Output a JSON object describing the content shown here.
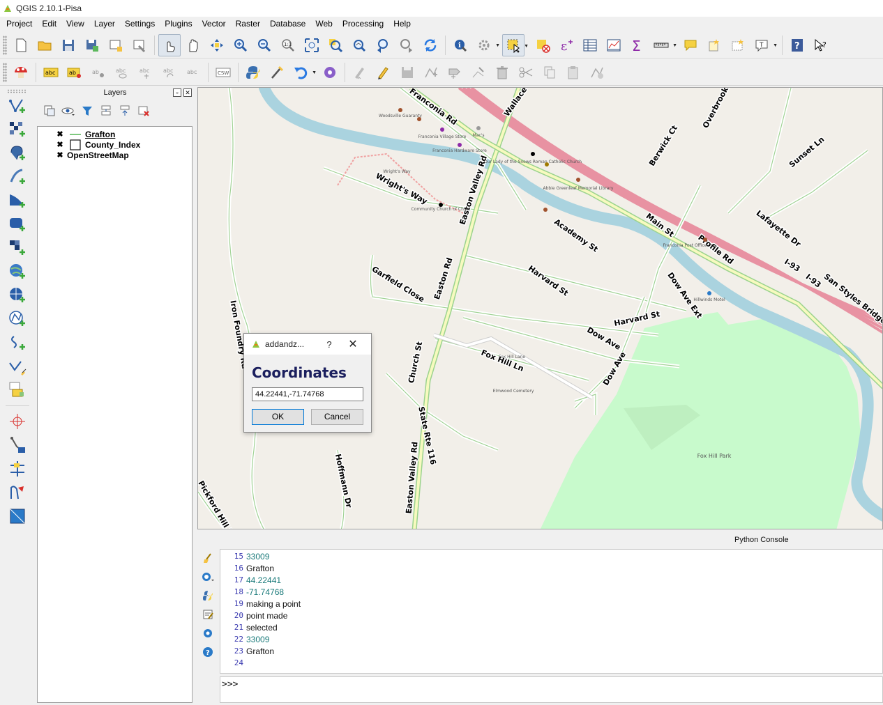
{
  "window": {
    "title": "QGIS 2.10.1-Pisa"
  },
  "menu": [
    "Project",
    "Edit",
    "View",
    "Layer",
    "Settings",
    "Plugins",
    "Vector",
    "Raster",
    "Database",
    "Web",
    "Processing",
    "Help"
  ],
  "toolbar1": {
    "icons": [
      "new-project-icon",
      "open-project-icon",
      "save-project-icon",
      "save-as-icon",
      "new-print-composer-icon",
      "composer-manager-icon",
      "touch-zoom-icon",
      "pan-icon",
      "pan-to-selection-icon",
      "zoom-in-icon",
      "zoom-out-icon",
      "zoom-native-icon",
      "zoom-full-icon",
      "zoom-to-selection-icon",
      "zoom-to-layer-icon",
      "zoom-last-icon",
      "zoom-next-icon",
      "refresh-icon",
      "identify-icon",
      "run-action-icon",
      "select-features-icon",
      "deselect-icon",
      "field-calculator-icon",
      "attribute-table-icon",
      "statistics-icon",
      "sum-icon",
      "measure-icon",
      "map-tips-icon",
      "new-bookmark-icon",
      "show-bookmarks-icon",
      "text-annotation-icon",
      "help-contents-icon",
      "whats-this-icon"
    ]
  },
  "toolbar2": {
    "csw_label": "CSW",
    "label_tool_text": "abc"
  },
  "layers_panel": {
    "title": "Layers",
    "layers": [
      {
        "name": "Grafton",
        "checked": true,
        "symbol": "line",
        "underline": true
      },
      {
        "name": "County_Index",
        "checked": true,
        "symbol": "polygon",
        "underline": false
      },
      {
        "name": "OpenStreetMap",
        "checked": true,
        "symbol": "none",
        "underline": false
      }
    ]
  },
  "map": {
    "road_labels": [
      "Franconia Rd",
      "Wallace",
      "Easton Valley Rd",
      "Wright's Way",
      "Overbrook",
      "Berwick Ct",
      "Sunset Ln",
      "Main St",
      "Academy St",
      "Lafayette Dr",
      "Profile Rd",
      "I-93",
      "I-93",
      "San Styles Bridge H",
      "Harvard St",
      "Harvard St",
      "Garfield Close",
      "Easton Rd",
      "Dow Ave Ext",
      "Iron Foundry Rd",
      "Dow Ave",
      "Dow Ave",
      "Church St",
      "Fox Hill Ln",
      "State Rte 116",
      "Easton Valley Rd",
      "Hoffmann Dr",
      "Pickford Hill R"
    ],
    "poi_labels": [
      "Woodsville Guaranty",
      "Franconia Village Store",
      "Franconia Hardware Store",
      "Mac's",
      "Our Lady of the Snows Roman Catholic Church",
      "Abbie Greenleaf Memorial Library",
      "Community Church of Christ",
      "Franconia Post Office",
      "Hillwinds Motel",
      "Elmwood Cemetery",
      "Fox Hill Park",
      "Fox Hill Lane",
      "Wright's Way"
    ],
    "colors": {
      "background": "#f2efe9",
      "water": "#aad3df",
      "park": "#c8facc",
      "motorway": "#e892a2",
      "primary": "#fcd6a4",
      "road_casing": "#8ac77a"
    }
  },
  "dialog": {
    "title": "addandz...",
    "help": "?",
    "close": "✕",
    "heading": "Coordinates",
    "value": "44.22441,-71.74768",
    "ok_label": "OK",
    "cancel_label": "Cancel"
  },
  "python_console": {
    "title": "Python Console",
    "prompt": ">>>",
    "lines": [
      {
        "n": "15",
        "text": "33009",
        "num": true
      },
      {
        "n": "16",
        "text": "Grafton",
        "num": false
      },
      {
        "n": "17",
        "text": "44.22441",
        "num": true
      },
      {
        "n": "18",
        "text": "-71.74768",
        "num": true
      },
      {
        "n": "19",
        "text": "making a point",
        "num": false
      },
      {
        "n": "20",
        "text": "point made",
        "num": false
      },
      {
        "n": "21",
        "text": "selected",
        "num": false
      },
      {
        "n": "22",
        "text": "33009",
        "num": true
      },
      {
        "n": "23",
        "text": "Grafton",
        "num": false
      },
      {
        "n": "24",
        "text": "",
        "num": false
      }
    ]
  }
}
